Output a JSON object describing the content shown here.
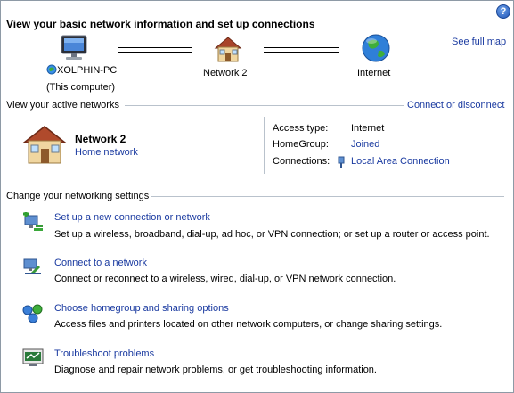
{
  "header": {
    "title": "View your basic network information and set up connections",
    "see_full_map": "See full map",
    "help_glyph": "?"
  },
  "map": {
    "computer_name": "XOLPHIN-PC",
    "computer_sub": "(This computer)",
    "network_name": "Network  2",
    "internet": "Internet"
  },
  "active": {
    "heading": "View your active networks",
    "connect_link": "Connect or disconnect",
    "network_name": "Network  2",
    "network_type": "Home network",
    "access_type_label": "Access type:",
    "access_type_value": "Internet",
    "homegroup_label": "HomeGroup:",
    "homegroup_value": "Joined",
    "connections_label": "Connections:",
    "connections_value": "Local Area Connection"
  },
  "settings": {
    "heading": "Change your networking settings",
    "tasks": [
      {
        "title": "Set up a new connection or network",
        "desc": "Set up a wireless, broadband, dial-up, ad hoc, or VPN connection; or set up a router or access point.",
        "icon": "new-connection-icon"
      },
      {
        "title": "Connect to a network",
        "desc": "Connect or reconnect to a wireless, wired, dial-up, or VPN network connection.",
        "icon": "connect-network-icon"
      },
      {
        "title": "Choose homegroup and sharing options",
        "desc": "Access files and printers located on other network computers, or change sharing settings.",
        "icon": "homegroup-icon"
      },
      {
        "title": "Troubleshoot problems",
        "desc": "Diagnose and repair network problems, or get troubleshooting information.",
        "icon": "troubleshoot-icon"
      }
    ]
  }
}
